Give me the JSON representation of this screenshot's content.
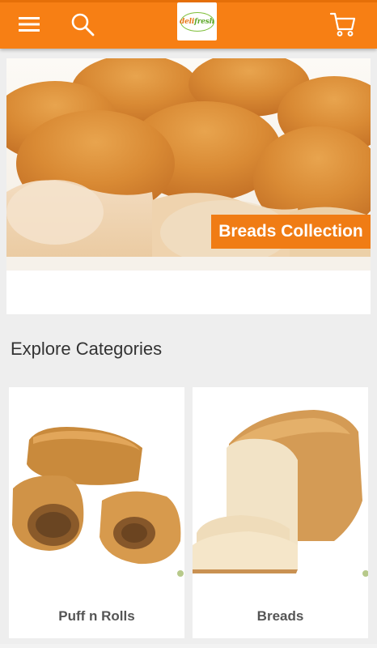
{
  "header": {
    "brand_color": "#f77f14",
    "menu_icon": "hamburger-menu-icon",
    "search_icon": "search-icon",
    "cart_icon": "cart-icon",
    "logo": {
      "text_part1": "deli",
      "text_part2": "fresh"
    }
  },
  "banner": {
    "label": "Breads Collection"
  },
  "explore": {
    "title": "Explore Categories",
    "categories": [
      {
        "label": "Puff n Rolls"
      },
      {
        "label": "Breads"
      }
    ]
  }
}
